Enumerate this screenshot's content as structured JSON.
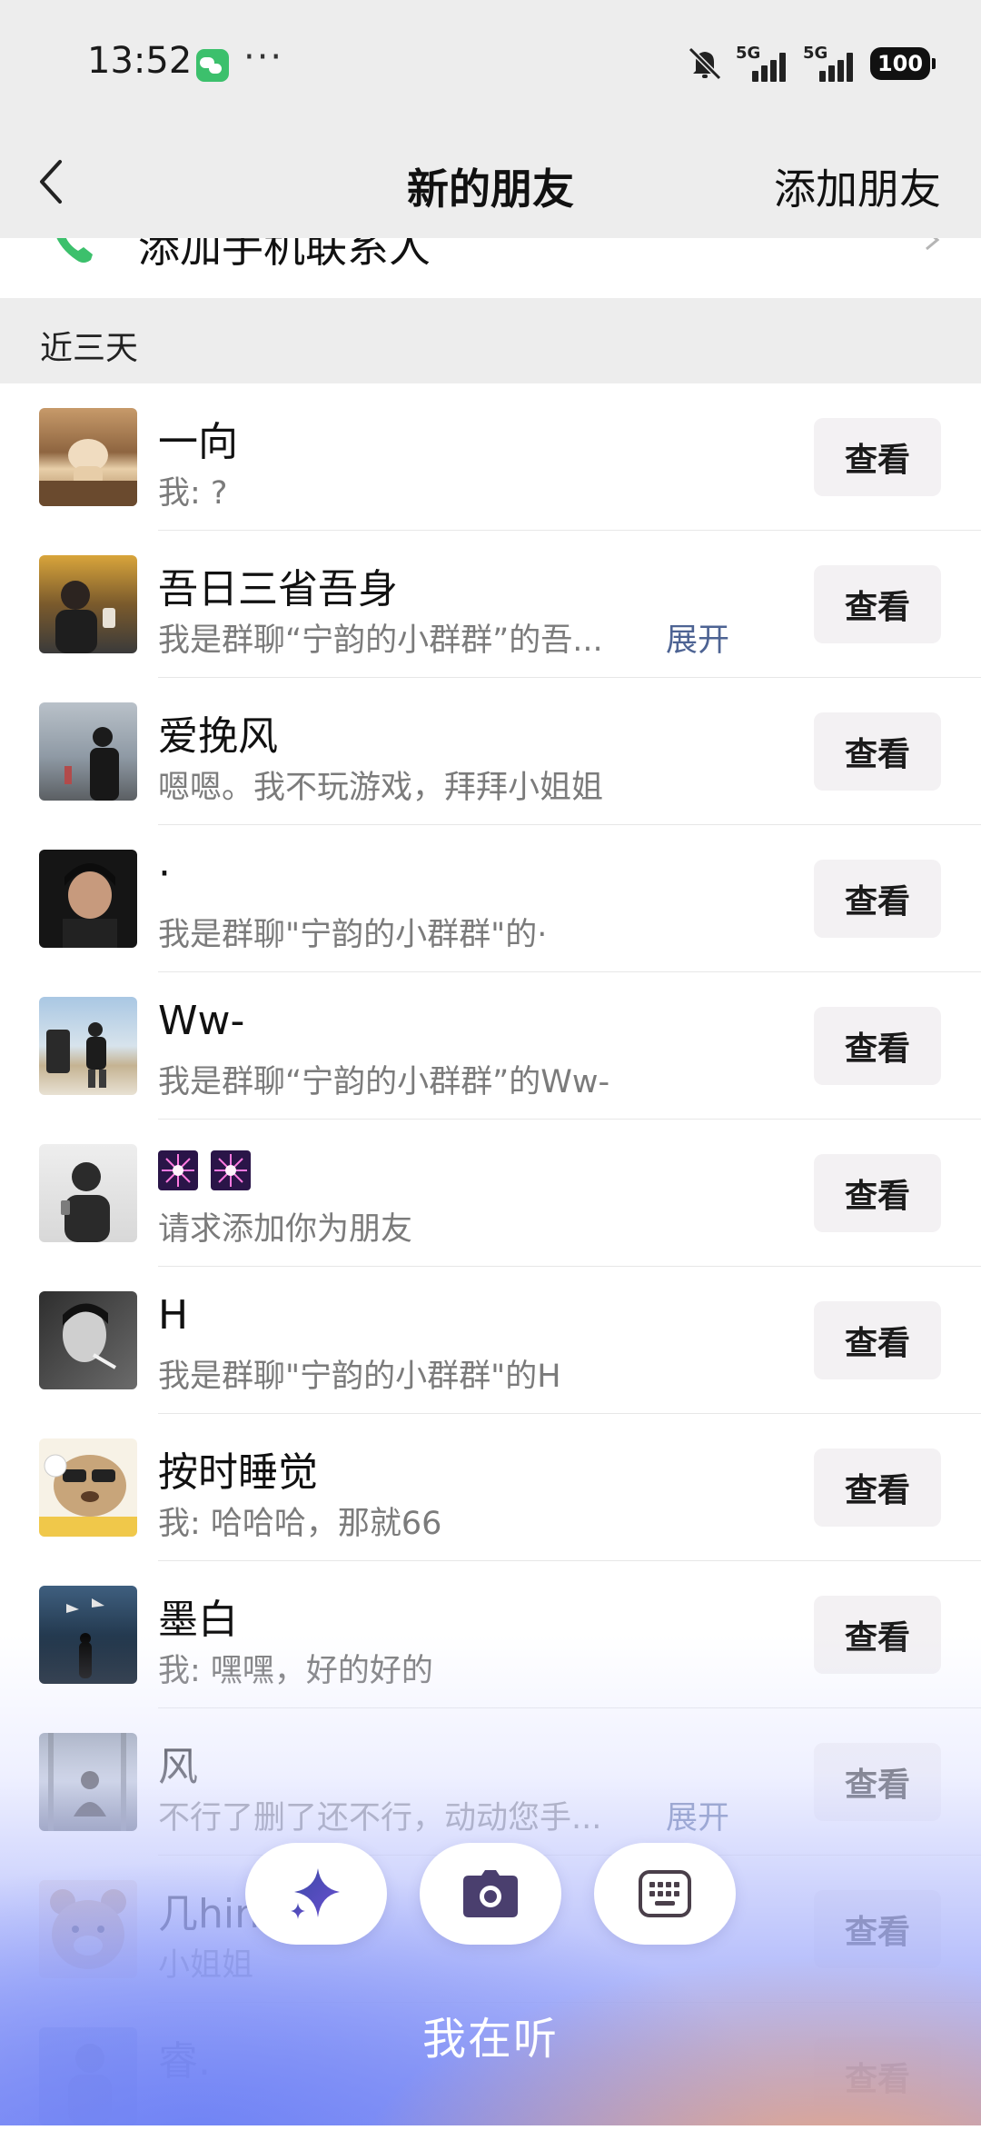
{
  "status_bar": {
    "time": "13:52",
    "more_indicator": "···",
    "network_1": "5G",
    "network_2": "5G",
    "battery": "100"
  },
  "nav": {
    "title": "新的朋友",
    "add_friends": "添加朋友"
  },
  "partial_row": {
    "label": "添加手机联系人"
  },
  "section": {
    "header": "近三天"
  },
  "friends": [
    {
      "name": "一向",
      "message": "我: ?",
      "button": "查看"
    },
    {
      "name": "吾日三省吾身",
      "message": "我是群聊“宁韵的小群群”的吾...",
      "expand": "展开",
      "button": "查看"
    },
    {
      "name": "爱挽风",
      "message": "嗯嗯。我不玩游戏，拜拜小姐姐",
      "button": "查看"
    },
    {
      "name": "·",
      "message": "我是群聊\"宁韵的小群群\"的·",
      "button": "查看"
    },
    {
      "name": "Ww-",
      "message": "我是群聊“宁韵的小群群”的Ww-",
      "button": "查看"
    },
    {
      "name": "",
      "message": "请求添加你为朋友",
      "button": "查看"
    },
    {
      "name": "H",
      "message": "我是群聊\"宁韵的小群群\"的H",
      "button": "查看"
    },
    {
      "name": "按时睡觉",
      "message": "我: 哈哈哈，那就66",
      "button": "查看"
    },
    {
      "name": "墨白",
      "message": "我: 嘿嘿，好的好的",
      "button": "查看"
    },
    {
      "name": "风",
      "message": "不行了删了还不行，动动您手...",
      "expand": "展开",
      "button": "查看"
    },
    {
      "name": "几hin",
      "message": "小姐姐",
      "button": "查看"
    },
    {
      "name": "睿.",
      "message": "",
      "button": "查看"
    }
  ],
  "voice": {
    "listening_text": "我在听"
  },
  "colors": {
    "nav_background": "#ededed",
    "link_blue": "#4d6393",
    "wechat_green": "#3cc06c",
    "button_background": "#f3f1f3"
  }
}
